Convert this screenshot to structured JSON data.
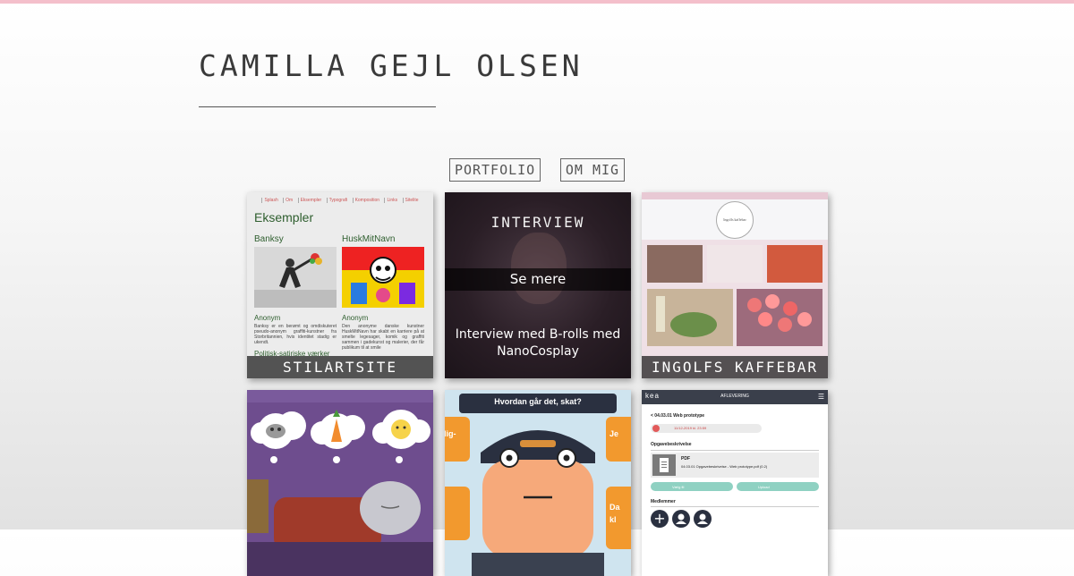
{
  "site": {
    "title": "CAMILLA GEJL OLSEN",
    "accent": "#f4bfcb"
  },
  "nav": {
    "portfolio": "PORTFOLIO",
    "about": "OM MIG"
  },
  "tiles": {
    "stilartsite": {
      "label": "STILARTSITE",
      "menu": [
        "Splash",
        "Om",
        "Eksempler",
        "Typografi",
        "Komposition",
        "Links",
        "Sitelite"
      ],
      "heading": "Eksempler",
      "artist1": "Banksy",
      "artist2": "HuskMitNavn",
      "sub1": "Anonym",
      "sub2": "Anonym",
      "text1": "Banksy er en berømt og omdiskuteret pseudo-anonym graffiti-kunstner fra Storbritannien, hvis identitet stadig er ukendt.",
      "text2": "Den anonyme danske kunstner HuskMitNavn har skabt en karriere på at smelte legesager, komik og graffiti sammen i gadekunst og malerier, der får publikum til at smile",
      "subheading": "Politisk-satiriske værker"
    },
    "interview": {
      "top": "INTERVIEW",
      "more": "Se mere",
      "desc1": "Interview med B-rolls med",
      "desc2": "NanoCosplay"
    },
    "ingolfs": {
      "label": "INGOLFS KAFFEBAR",
      "logo_text": "Ingolfs kaffebar"
    },
    "thoughts": {},
    "hvordan": {
      "question": "Hvordan går det, skat?",
      "left_frag": "lig-",
      "right_frag": "Je",
      "right_frag2": "Da",
      "right_frag3": "kl"
    },
    "kea": {
      "brand": "kea",
      "title": "AFLEVERING",
      "back": "< 04.03.01 Web prototype",
      "date": "11/12-2019 kl. 23:59",
      "section": "Opgavebeskrivelse",
      "file_type": "PDF",
      "file_name": "04.03.01 Opgavebeskrivelse - Web prototype.pdf (0.2)",
      "btn1": "Vælg fil",
      "btn2": "Upload",
      "members": "Medlemmer"
    }
  }
}
